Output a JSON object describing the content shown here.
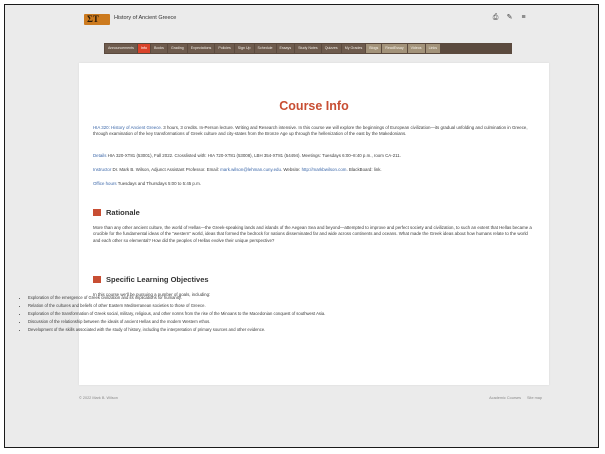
{
  "site": {
    "title": "History of Ancient Greece"
  },
  "top_icons": [
    "print-icon",
    "edit-icon",
    "menu-icon"
  ],
  "nav": [
    {
      "label": "Announcements",
      "state": "normal"
    },
    {
      "label": "Info",
      "state": "active"
    },
    {
      "label": "Books",
      "state": "normal"
    },
    {
      "label": "Grading",
      "state": "normal"
    },
    {
      "label": "Expectations",
      "state": "normal"
    },
    {
      "label": "Policies",
      "state": "normal"
    },
    {
      "label": "Sign Up",
      "state": "normal"
    },
    {
      "label": "Schedule",
      "state": "normal"
    },
    {
      "label": "Essays",
      "state": "normal"
    },
    {
      "label": "Study Notes",
      "state": "normal"
    },
    {
      "label": "Quizzes",
      "state": "normal"
    },
    {
      "label": "My Grades",
      "state": "normal"
    },
    {
      "label": "Blogs",
      "state": "muted"
    },
    {
      "label": "ReadEssay",
      "state": "muted"
    },
    {
      "label": "Videos",
      "state": "muted"
    },
    {
      "label": "Links",
      "state": "muted"
    }
  ],
  "main": {
    "title": "Course Info",
    "intro": {
      "label": "HIA 320: History of Ancient Greece.",
      "text": " 3 hours, 3 credits. In-Person lecture. Writing and Research intensive. In this course we will explore the beginnings of European civilization—its gradual unfolding and culmination in Greece, through examination of the key transformations of Greek culture and city-states from the Bronze Age up through the hellenization of the east by the Makedonians."
    },
    "details": {
      "label": "Details",
      "text": " HIA 320-XT81 (53001), Fall 2022. Crosslisted with: HIA 720-XT81 (53008), LBH 354-XT81 (54494). Meetings: Tuesdays 6:00–8:40 p.m., room CA-211."
    },
    "instructor": {
      "label": "Instructor",
      "text": " Dr. Mark B. Wilson, Adjunct Assistant Professor. Email: ",
      "email": "mark.wilson@lehman.cuny.edu",
      "text2": ". Website: ",
      "site": "http://markbwilson.com",
      "text3": ". BlackBoard: link."
    },
    "office": {
      "label": "Office hours",
      "text": " Tuesdays and Thursdays 5:00 to 5:45 p.m."
    },
    "rationale": {
      "title": "Rationale",
      "text": "More than any other ancient culture, the world of Hellas—the Greek-speaking lands and islands of the Aegean Sea and beyond—attempted to improve and perfect society and civilization, to such an extent that Hellas became a crucible for the fundamental ideas of the \"western\" world, ideas that formed the bedrock for nations disseminated far and wide across continents and oceans. What made the Greek ideas about how humans relate to the world and each other so elemental? How did the peoples of Hellas evolve their unique perspective?"
    },
    "objectives": {
      "title": "Specific Learning Objectives",
      "intro": "In this course we'll be pursuing a number of goals, including:",
      "items": [
        "Exploration of the emergence of Greek civilization and its implications for humanity.",
        "Relation of the cultures and beliefs of other Eastern Mediterranean societies to those of Greece.",
        "Exploration of the transformation of Greek social, military, religious, and other norms from the rise of the Minoans to the Macedonian conquest of southwest Asia.",
        "Discussion of the relationship between the ideals of ancient Hellas and the modern Western ethos.",
        "Development of the skills associated with the study of history, including the interpretation of primary sources and other evidence."
      ]
    }
  },
  "footer": {
    "copyright": "© 2022 Mark B. Wilson",
    "links": [
      "Academic Courses",
      "Site map"
    ]
  }
}
